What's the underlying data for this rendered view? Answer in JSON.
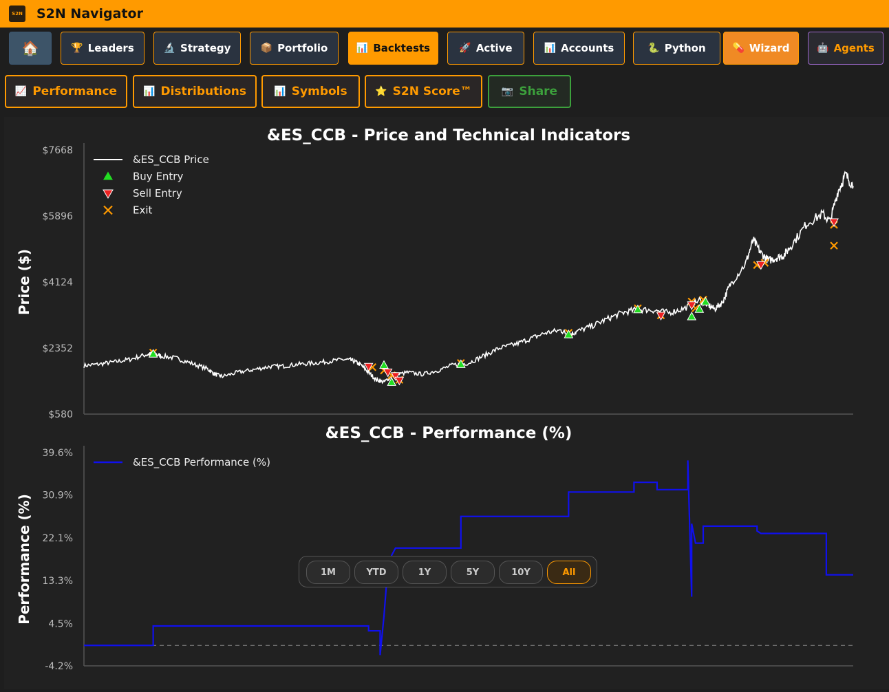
{
  "app": {
    "title": "S2N Navigator",
    "logo_text": "S2N"
  },
  "nav": [
    {
      "label": "",
      "icon": "home-icon",
      "glyph": "🏠",
      "name": "home"
    },
    {
      "label": "Leaders",
      "icon": "trophy-icon",
      "glyph": "🏆",
      "name": "leaders"
    },
    {
      "label": "Strategy",
      "icon": "microscope-icon",
      "glyph": "🔬",
      "name": "strategy"
    },
    {
      "label": "Portfolio",
      "icon": "package-icon",
      "glyph": "📦",
      "name": "portfolio"
    },
    {
      "label": "Backtests",
      "icon": "bar-chart-icon",
      "glyph": "📊",
      "name": "backtests"
    },
    {
      "label": "Active",
      "icon": "rocket-icon",
      "glyph": "🚀",
      "name": "active"
    },
    {
      "label": "Accounts",
      "icon": "bar-chart-icon",
      "glyph": "📊",
      "name": "accounts"
    },
    {
      "label": "Python",
      "icon": "python-icon",
      "glyph": "🐍",
      "name": "python"
    },
    {
      "label": "Wizard",
      "icon": "pill-icon",
      "glyph": "💊",
      "name": "wizard"
    },
    {
      "label": "Agents",
      "icon": "robot-icon",
      "glyph": "🤖",
      "name": "agents"
    }
  ],
  "subnav": [
    {
      "label": "Performance",
      "icon": "line-chart-icon",
      "glyph": "📈",
      "name": "performance"
    },
    {
      "label": "Distributions",
      "icon": "bar-chart-icon",
      "glyph": "📊",
      "name": "distributions"
    },
    {
      "label": "Symbols",
      "icon": "bar-chart-icon",
      "glyph": "📊",
      "name": "symbols"
    },
    {
      "label": "S2N Score™",
      "icon": "star-icon",
      "glyph": "⭐",
      "name": "s2n-score"
    },
    {
      "label": "Share",
      "icon": "camera-icon",
      "glyph": "📷",
      "name": "share"
    }
  ],
  "range_buttons": [
    "1M",
    "YTD",
    "1Y",
    "5Y",
    "10Y",
    "All"
  ],
  "range_selected": "All",
  "colors": {
    "accent": "#ff9a00",
    "buy": "#22dd22",
    "sell": "#ee2222",
    "exit": "#ff9a00",
    "performance": "#1010ee",
    "price": "#ffffff"
  },
  "chart_data": [
    {
      "type": "line",
      "title": "&ES_CCB - Price and Technical Indicators",
      "ylabel": "Price ($)",
      "xlabel": "",
      "ylim": [
        580,
        7668
      ],
      "yticks": [
        "$7668",
        "$5896",
        "$4124",
        "$2352",
        "$580"
      ],
      "ytick_values": [
        7668,
        5896,
        4124,
        2352,
        580
      ],
      "legend_placement": "top-left",
      "legend": [
        "&ES_CCB Price",
        "Buy Entry",
        "Sell Entry",
        "Exit"
      ],
      "x_domain": [
        0,
        100
      ],
      "series": [
        {
          "name": "&ES_CCB Price",
          "points": [
            [
              0,
              1880
            ],
            [
              2,
              1920
            ],
            [
              4,
              1980
            ],
            [
              6,
              2050
            ],
            [
              8,
              2170
            ],
            [
              9,
              2200
            ],
            [
              10,
              2140
            ],
            [
              12,
              2080
            ],
            [
              14,
              1940
            ],
            [
              16,
              1800
            ],
            [
              17,
              1650
            ],
            [
              18,
              1590
            ],
            [
              20,
              1700
            ],
            [
              22,
              1770
            ],
            [
              24,
              1850
            ],
            [
              26,
              1870
            ],
            [
              28,
              1920
            ],
            [
              30,
              1950
            ],
            [
              32,
              2000
            ],
            [
              34,
              2050
            ],
            [
              35,
              2010
            ],
            [
              36,
              1900
            ],
            [
              37,
              1700
            ],
            [
              38,
              1500
            ],
            [
              39,
              1440
            ],
            [
              40,
              1600
            ],
            [
              42,
              1700
            ],
            [
              44,
              1650
            ],
            [
              46,
              1750
            ],
            [
              48,
              1900
            ],
            [
              50,
              1950
            ],
            [
              52,
              2150
            ],
            [
              54,
              2350
            ],
            [
              56,
              2450
            ],
            [
              58,
              2600
            ],
            [
              60,
              2760
            ],
            [
              62,
              2830
            ],
            [
              63,
              2700
            ],
            [
              64,
              2790
            ],
            [
              66,
              2940
            ],
            [
              68,
              3130
            ],
            [
              70,
              3300
            ],
            [
              72,
              3390
            ],
            [
              74,
              3370
            ],
            [
              76,
              3300
            ],
            [
              78,
              3410
            ],
            [
              80,
              3640
            ],
            [
              81,
              3520
            ],
            [
              82,
              3400
            ],
            [
              83,
              3580
            ],
            [
              84,
              4050
            ],
            [
              86,
              4620
            ],
            [
              87,
              5250
            ],
            [
              88,
              4900
            ],
            [
              89,
              4700
            ],
            [
              90,
              4770
            ],
            [
              91,
              4840
            ],
            [
              92,
              5120
            ],
            [
              94,
              5700
            ],
            [
              96,
              5950
            ],
            [
              97,
              5750
            ],
            [
              98,
              6550
            ],
            [
              99,
              7000
            ],
            [
              100,
              6700
            ]
          ]
        }
      ],
      "buy_entries": [
        [
          9,
          2200
        ],
        [
          39,
          1900
        ],
        [
          40,
          1440
        ],
        [
          49,
          1920
        ],
        [
          63,
          2720
        ],
        [
          72,
          3390
        ],
        [
          79,
          3200
        ],
        [
          80,
          3400
        ],
        [
          80.8,
          3600
        ]
      ],
      "sell_entries": [
        [
          37,
          1850
        ],
        [
          39.5,
          1700
        ],
        [
          40.5,
          1600
        ],
        [
          41,
          1480
        ],
        [
          75,
          3220
        ],
        [
          79,
          3500
        ],
        [
          88,
          4580
        ],
        [
          97.5,
          5730
        ]
      ],
      "exits": [
        [
          9,
          2230
        ],
        [
          37.5,
          1840
        ],
        [
          39,
          1750
        ],
        [
          40,
          1620
        ],
        [
          41,
          1500
        ],
        [
          49,
          1950
        ],
        [
          63,
          2760
        ],
        [
          72,
          3420
        ],
        [
          75,
          3230
        ],
        [
          79,
          3600
        ],
        [
          79.5,
          3420
        ],
        [
          80.5,
          3650
        ],
        [
          87.5,
          4580
        ],
        [
          88.5,
          4640
        ],
        [
          97.5,
          5660
        ],
        [
          97.5,
          5100
        ]
      ]
    },
    {
      "type": "line",
      "title": "&ES_CCB - Performance (%)",
      "ylabel": "Performance (%)",
      "xlabel": "",
      "ylim": [
        -4.2,
        39.6
      ],
      "yticks": [
        "39.6%",
        "30.9%",
        "22.1%",
        "13.3%",
        "4.5%",
        "-4.2%"
      ],
      "ytick_values": [
        39.6,
        30.9,
        22.1,
        13.3,
        4.5,
        -4.2
      ],
      "zero_line": 0,
      "legend_placement": "top-left",
      "legend": [
        "&ES_CCB Performance (%)"
      ],
      "x_domain": [
        0,
        100
      ],
      "series": [
        {
          "name": "&ES_CCB Performance (%)",
          "points": [
            [
              0,
              0
            ],
            [
              9,
              0
            ],
            [
              9,
              4
            ],
            [
              37,
              4
            ],
            [
              37,
              3
            ],
            [
              38.5,
              3
            ],
            [
              38.5,
              -2
            ],
            [
              39,
              6
            ],
            [
              39.2,
              10
            ],
            [
              39.4,
              14
            ],
            [
              40,
              14
            ],
            [
              40,
              18.5
            ],
            [
              40.5,
              20
            ],
            [
              49,
              20
            ],
            [
              49,
              26.5
            ],
            [
              63,
              26.5
            ],
            [
              63,
              31.5
            ],
            [
              71.5,
              31.5
            ],
            [
              71.5,
              33.5
            ],
            [
              74.5,
              33.5
            ],
            [
              74.5,
              32
            ],
            [
              78.5,
              32
            ],
            [
              78.5,
              38
            ],
            [
              79,
              10
            ],
            [
              79,
              25
            ],
            [
              79.5,
              21
            ],
            [
              80.5,
              21
            ],
            [
              80.5,
              24.5
            ],
            [
              87.5,
              24.5
            ],
            [
              87.5,
              23.5
            ],
            [
              88,
              23
            ],
            [
              96.5,
              23
            ],
            [
              96.5,
              14.5
            ],
            [
              100,
              14.5
            ]
          ]
        }
      ]
    }
  ]
}
